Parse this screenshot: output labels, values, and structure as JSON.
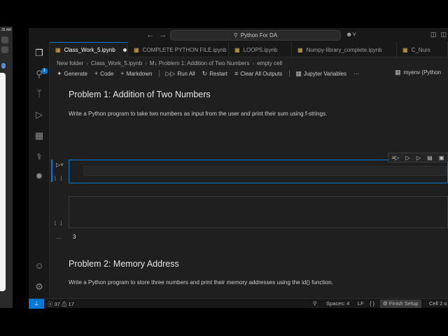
{
  "desktop": {
    "clock": "35 AM"
  },
  "titlebar": {
    "search_text": "Python For DA",
    "back_icon": "arrow-left-icon",
    "forward_icon": "arrow-right-icon"
  },
  "activity_bar": {
    "explorer_badge": "1"
  },
  "tabs": [
    {
      "label": "Class_Work_5.ipynb",
      "active": true,
      "modified": true
    },
    {
      "label": "COMPLETE PYTHON FILE.ipynb",
      "active": false
    },
    {
      "label": "LOOPS.ipynb",
      "active": false
    },
    {
      "label": "Numpy-library_complete.ipynb",
      "active": false
    },
    {
      "label": "C_Num",
      "active": false
    }
  ],
  "breadcrumb": [
    "New folder",
    "Class_Work_5.ipynb",
    "M↓ Problem 1: Addition of Two Numbers",
    "empty cell"
  ],
  "toolbar": {
    "generate": "Generate",
    "code": "Code",
    "markdown": "Markdown",
    "run_all": "Run All",
    "restart": "Restart",
    "clear_outputs": "Clear All Outputs",
    "variables": "Jupyter Variables",
    "more": "···",
    "kernel": "myenv (Python"
  },
  "notebook": {
    "cell1_title": "Problem 1: Addition of Two Numbers",
    "cell1_text": "Write a Python program to take two numbers as input from the user and print their sum using f-strings.",
    "empty_marker": "[ ]",
    "output_ellipsis": "…",
    "output_value": "3",
    "cell2_title": "Problem 2: Memory Address",
    "cell2_text": "Write a Python program to store three numbers and print their memory addresses using the id() function."
  },
  "statusbar": {
    "errors": "37",
    "warnings": "17",
    "spaces": "Spaces: 4",
    "eol": "LF",
    "braces": "{ }",
    "finish_setup": "Finish Setup",
    "cell_info": "Cell 2 o"
  }
}
